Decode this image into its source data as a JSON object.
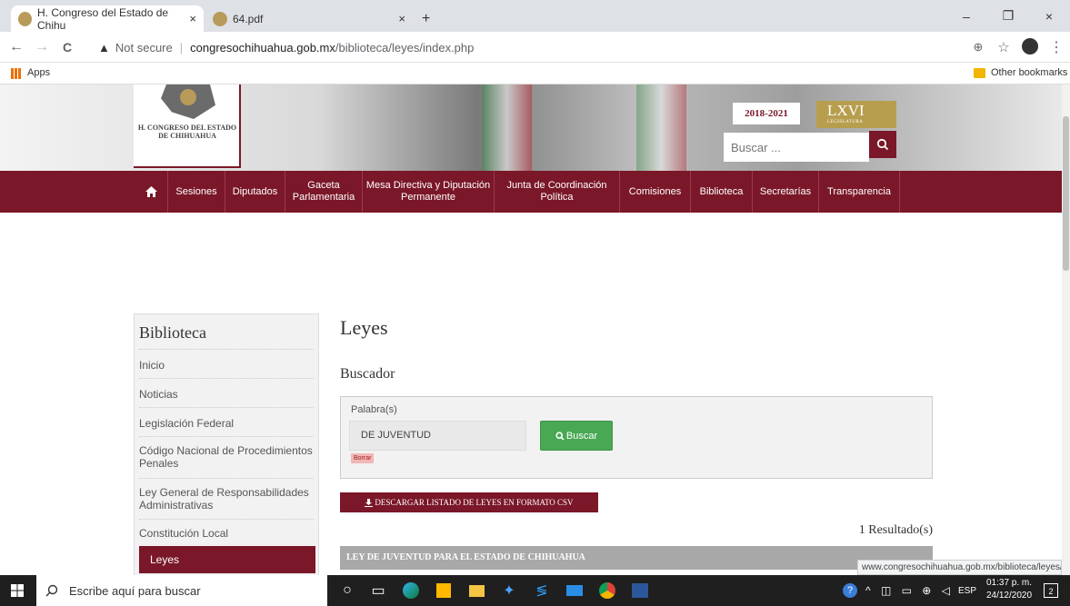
{
  "browser": {
    "tabs": [
      {
        "title": "H. Congreso del Estado de Chihu",
        "close": "×",
        "active": true
      },
      {
        "title": "64.pdf",
        "close": "×",
        "active": false
      }
    ],
    "new_tab": "+",
    "window_controls": {
      "minimize": "–",
      "restore": "❐",
      "close": "×"
    },
    "nav": {
      "back": "←",
      "forward": "→",
      "reload": "C"
    },
    "address": {
      "warning": "▲",
      "security_label": "Not secure",
      "separator": "|",
      "host": "congresochihuahua.gob.mx",
      "path": "/biblioteca/leyes/index.php"
    },
    "toolbar_icons": {
      "zoom": "⊕",
      "star": "☆",
      "menu": "⋮"
    },
    "bookmarks": {
      "apps": "Apps",
      "other": "Other bookmarks"
    }
  },
  "site": {
    "logo_text": "H. CONGRESO DEL ESTADO DE CHIHUAHUA",
    "legislature_years": "2018-2021",
    "legislature_number": "LXVI",
    "legislature_label": "LEGISLATURA",
    "search_placeholder": "Buscar ...",
    "nav": [
      {
        "label": "Sesiones"
      },
      {
        "label": "Diputados"
      },
      {
        "label": "Gaceta Parlamentaria"
      },
      {
        "label": "Mesa Directiva y Diputación Permanente"
      },
      {
        "label": "Junta de Coordinación Política"
      },
      {
        "label": "Comisiones"
      },
      {
        "label": "Biblioteca"
      },
      {
        "label": "Secretarías"
      },
      {
        "label": "Transparencia"
      }
    ]
  },
  "sidebar": {
    "title": "Biblioteca",
    "items": [
      {
        "label": "Inicio"
      },
      {
        "label": "Noticias"
      },
      {
        "label": "Legislación Federal"
      },
      {
        "label": "Código Nacional de Procedimientos Penales"
      },
      {
        "label": "Ley General de Responsabilidades Administrativas"
      },
      {
        "label": "Constitución Local"
      },
      {
        "label": "Leyes"
      }
    ]
  },
  "main": {
    "title": "Leyes",
    "subtitle": "Buscador",
    "search_label": "Palabra(s)",
    "search_value": "DE JUVENTUD",
    "search_button": "Buscar",
    "clear_button": "Borrar",
    "csv_button": "DESCARGAR LISTADO DE LEYES EN FORMATO CSV",
    "results_count": "1 Resultado(s)",
    "result_title": "LEY DE JUVENTUD PARA EL ESTADO DE CHIHUAHUA"
  },
  "status_url": "www.congresochihuahua.gob.mx/biblioteca/leyes/",
  "taskbar": {
    "search_placeholder": "Escribe aquí para buscar",
    "lang": "ESP",
    "time": "01:37 p. m.",
    "date": "24/12/2020",
    "notifications": "2"
  },
  "colors": {
    "brand": "#7a1728",
    "gold": "#b79e4e",
    "success": "#48a853"
  }
}
